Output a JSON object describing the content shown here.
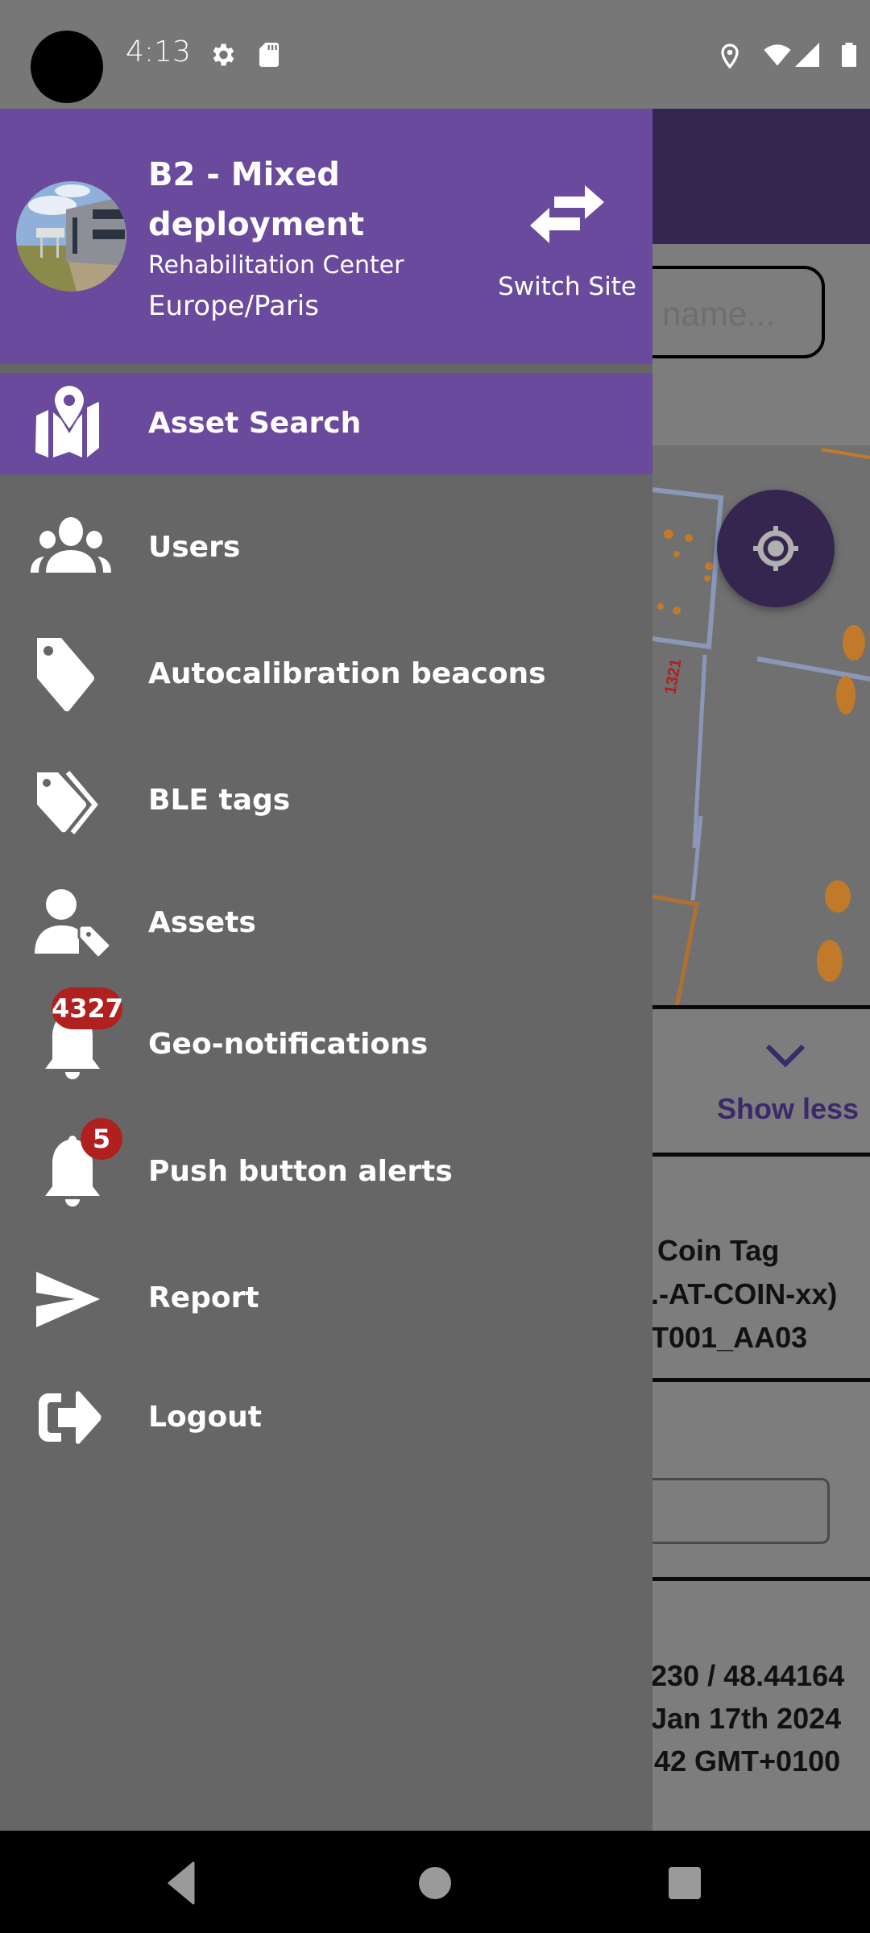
{
  "status_bar": {
    "time": "4:13",
    "left_icons": [
      "settings-gear-icon",
      "sd-card-icon"
    ],
    "right_icons": [
      "location-icon",
      "wifi-icon",
      "cellular-signal-icon",
      "battery-icon"
    ]
  },
  "drawer": {
    "header": {
      "site_name": "B2 - Mixed deployment",
      "site_type": "Rehabilitation Center",
      "timezone": "Europe/Paris",
      "switch_label": "Switch Site"
    },
    "items": [
      {
        "label": "Asset Search",
        "icon": "map-pin-icon",
        "active": true
      },
      {
        "label": "Users",
        "icon": "users-icon",
        "active": false
      },
      {
        "label": "Autocalibration beacons",
        "icon": "tag-icon",
        "active": false
      },
      {
        "label": "BLE tags",
        "icon": "tags-icon",
        "active": false
      },
      {
        "label": "Assets",
        "icon": "user-tag-icon",
        "active": false
      },
      {
        "label": "Geo-notifications",
        "icon": "bell-icon",
        "badge": "4327",
        "active": false
      },
      {
        "label": "Push button alerts",
        "icon": "bell-icon",
        "badge": "5",
        "active": false
      },
      {
        "label": "Report",
        "icon": "send-icon",
        "active": false
      },
      {
        "label": "Logout",
        "icon": "logout-icon",
        "active": false
      }
    ]
  },
  "background": {
    "search_placeholder": "name...",
    "show_less": "Show less",
    "tag_lines": [
      "Coin Tag",
      ".-AT-COIN-xx)",
      "T001_AA03"
    ],
    "location_lines": [
      "230 / 48.44164",
      "Jan 17th 2024",
      "42 GMT+0100"
    ]
  },
  "colors": {
    "drawer_accent": "#6a4a9c",
    "app_bar": "#35264f",
    "badge": "#b0201f"
  }
}
